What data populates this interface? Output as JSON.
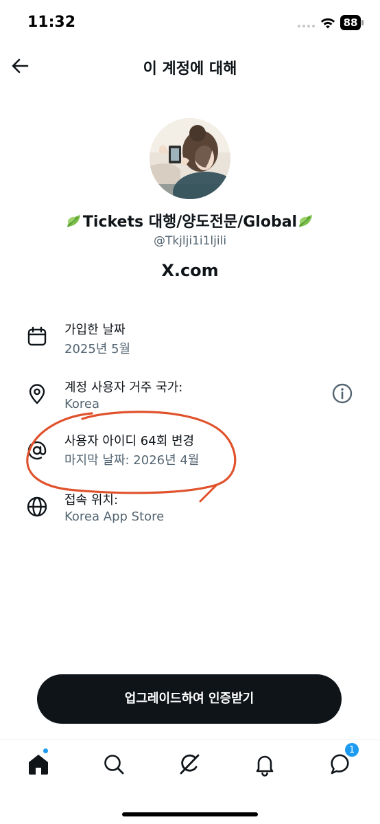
{
  "status_bar": {
    "time": "11:32",
    "battery": "88"
  },
  "header": {
    "title": "이 계정에 대해"
  },
  "profile": {
    "display_name": "Tickets 대행/양도전문/Global",
    "handle": "@Tkjlji1i1ljili",
    "source": "X.com"
  },
  "info": {
    "joined": {
      "label": "가입한 날짜",
      "value": "2025년 5월",
      "icon": "calendar-icon"
    },
    "country": {
      "label": "계정 사용자 거주 국가:",
      "value": "Korea",
      "icon": "location-pin-icon"
    },
    "username": {
      "label": "사용자 아이디 64회 변경",
      "value": "마지막 날짜: 2026년 4월",
      "icon": "at-sign-icon"
    },
    "connected": {
      "label": "접속 위치:",
      "value": "Korea App Store",
      "icon": "globe-icon"
    }
  },
  "cta": {
    "label": "업그레이드하여 인증받기"
  },
  "tabs": {
    "messages_badge": "1",
    "items": [
      "home-icon",
      "search-icon",
      "grok-icon",
      "bell-icon",
      "messages-icon"
    ]
  },
  "colors": {
    "text_primary": "#0f1419",
    "text_secondary": "#536471",
    "accent": "#1d9bf0",
    "annotation": "#e0522c"
  }
}
